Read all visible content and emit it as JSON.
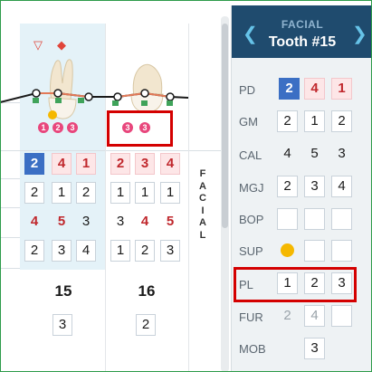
{
  "header": {
    "subtitle": "FACIAL",
    "title": "Tooth #15",
    "prev_icon": "chevron-left-icon",
    "next_icon": "chevron-right-icon"
  },
  "side_label": "FACIAL",
  "teeth": [
    {
      "number": "15",
      "symbols": [
        "▽",
        "◆"
      ],
      "badges": [
        "1",
        "2",
        "3"
      ],
      "pd": [
        "2",
        "4",
        "1"
      ],
      "gm": [
        "2",
        "1",
        "2"
      ],
      "cal": [
        "4",
        "5",
        "3"
      ],
      "mgj": [
        "2",
        "3",
        "4"
      ],
      "mob": "3"
    },
    {
      "number": "16",
      "badges": [
        "3",
        "3"
      ],
      "pd": [
        "2",
        "3",
        "4"
      ],
      "gm": [
        "1",
        "1",
        "1"
      ],
      "cal": [
        "3",
        "4",
        "5"
      ],
      "mgj": [
        "1",
        "2",
        "3"
      ],
      "mob": "2"
    }
  ],
  "panel": {
    "rows": [
      {
        "label": "PD",
        "values": [
          "2",
          "4",
          "1"
        ]
      },
      {
        "label": "GM",
        "values": [
          "2",
          "1",
          "2"
        ]
      },
      {
        "label": "CAL",
        "values": [
          "4",
          "5",
          "3"
        ]
      },
      {
        "label": "MGJ",
        "values": [
          "2",
          "3",
          "4"
        ]
      },
      {
        "label": "BOP",
        "values": [
          "",
          "",
          ""
        ]
      },
      {
        "label": "SUP",
        "values": [
          "",
          "",
          ""
        ]
      },
      {
        "label": "PL",
        "values": [
          "1",
          "2",
          "3"
        ]
      },
      {
        "label": "FUR",
        "values": [
          "2",
          "4",
          ""
        ]
      },
      {
        "label": "MOB",
        "values": [
          "3"
        ]
      }
    ]
  },
  "colors": {
    "header_bg": "#1f4b6e",
    "accent_blue": "#3b6fc4",
    "pink_cell": "#fde6e7",
    "red_text": "#c0282d",
    "highlight_column": "#e4f2f8",
    "suppuration_dot": "#f5b800",
    "annotation_red": "#d40000"
  }
}
